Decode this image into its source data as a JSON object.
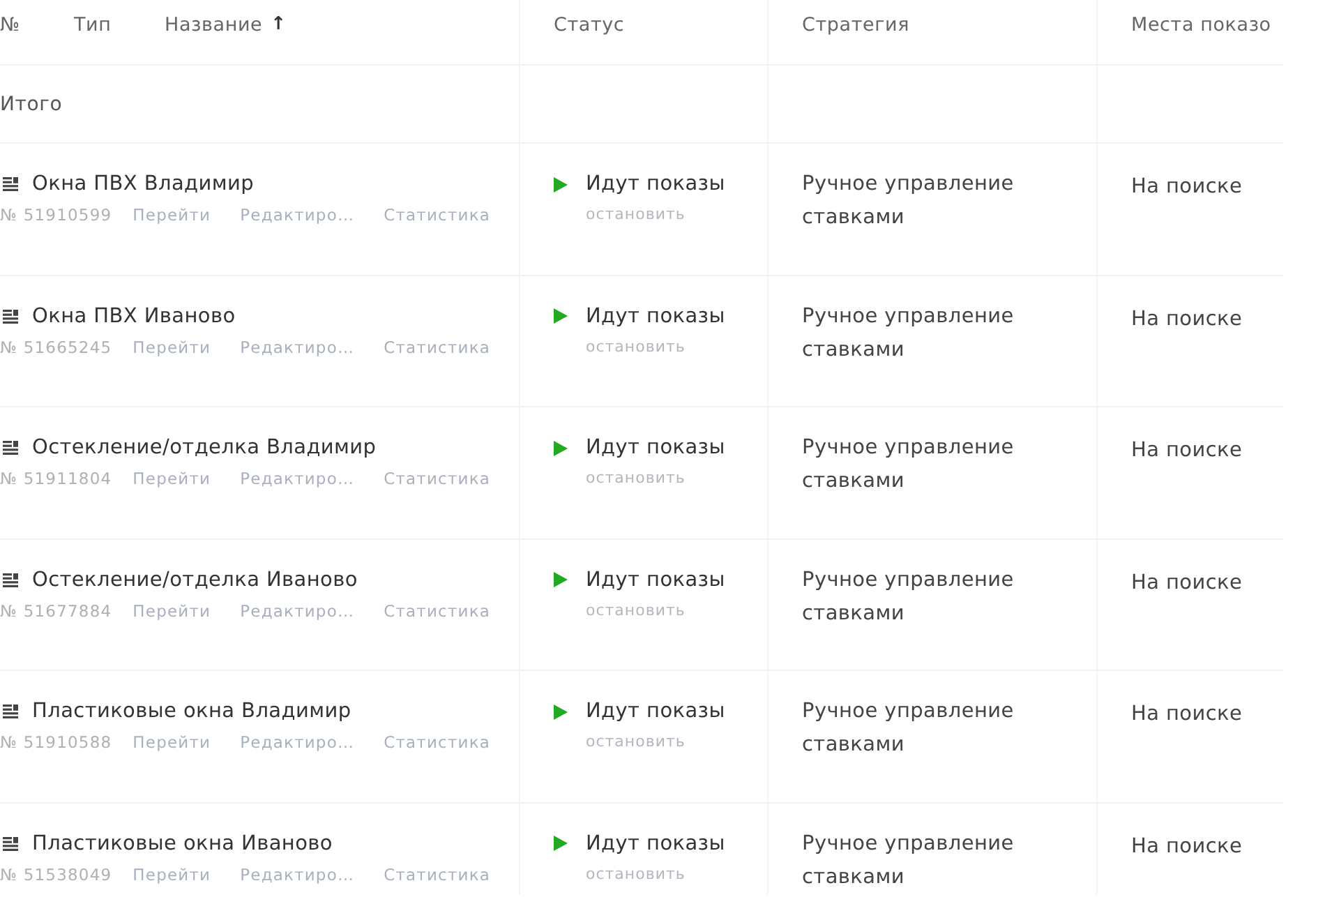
{
  "table": {
    "columns": [
      {
        "label": "№"
      },
      {
        "label": "Тип"
      },
      {
        "label": "Название",
        "sort_mark": "↑"
      },
      {
        "label": "Статус"
      },
      {
        "label": "Стратегия"
      },
      {
        "label": "Места показо"
      }
    ],
    "total_row": {
      "label": "Итого"
    },
    "rows": [
      {
        "name": "Окна ПВХ Владимир",
        "number": "№ 51910599",
        "links": [
          "Перейти",
          "Редактиро…",
          "Статистика"
        ],
        "status": {
          "kind": "running",
          "label": "Идут показы",
          "action": "остановить"
        },
        "strategy": "Ручное управление ставками",
        "placements": "На поиске"
      },
      {
        "name": "Окна ПВХ Иваново",
        "number": "№ 51665245",
        "links": [
          "Перейти",
          "Редактиро…",
          "Статистика"
        ],
        "status": {
          "kind": "running",
          "label": "Идут показы",
          "action": "остановить"
        },
        "strategy": "Ручное управление ставками",
        "placements": "На поиске"
      },
      {
        "name": "Остекление/отделка Владимир",
        "number": "№ 51911804",
        "links": [
          "Перейти",
          "Редактиро…",
          "Статистика"
        ],
        "status": {
          "kind": "running",
          "label": "Идут показы",
          "action": "остановить"
        },
        "strategy": "Ручное управление ставками",
        "placements": "На поиске"
      },
      {
        "name": "Остекление/отделка Иваново",
        "number": "№ 51677884",
        "links": [
          "Перейти",
          "Редактиро…",
          "Статистика"
        ],
        "status": {
          "kind": "running",
          "label": "Идут показы",
          "action": "остановить"
        },
        "strategy": "Ручное управление ставками",
        "placements": "На поиске"
      },
      {
        "name": "Пластиковые окна Владимир",
        "number": "№ 51910588",
        "links": [
          "Перейти",
          "Редактиро…",
          "Статистика"
        ],
        "status": {
          "kind": "running",
          "label": "Идут показы",
          "action": "остановить"
        },
        "strategy": "Ручное управление ставками",
        "placements": "На поиске"
      },
      {
        "name": "Пластиковые окна Иваново",
        "number": "№ 51538049",
        "links": [
          "Перейти",
          "Редактиро…",
          "Статистика"
        ],
        "status": {
          "kind": "running",
          "label": "Идут показы",
          "action": "остановить"
        },
        "strategy": "Ручное управление ставками",
        "placements": "На поиске"
      }
    ]
  }
}
